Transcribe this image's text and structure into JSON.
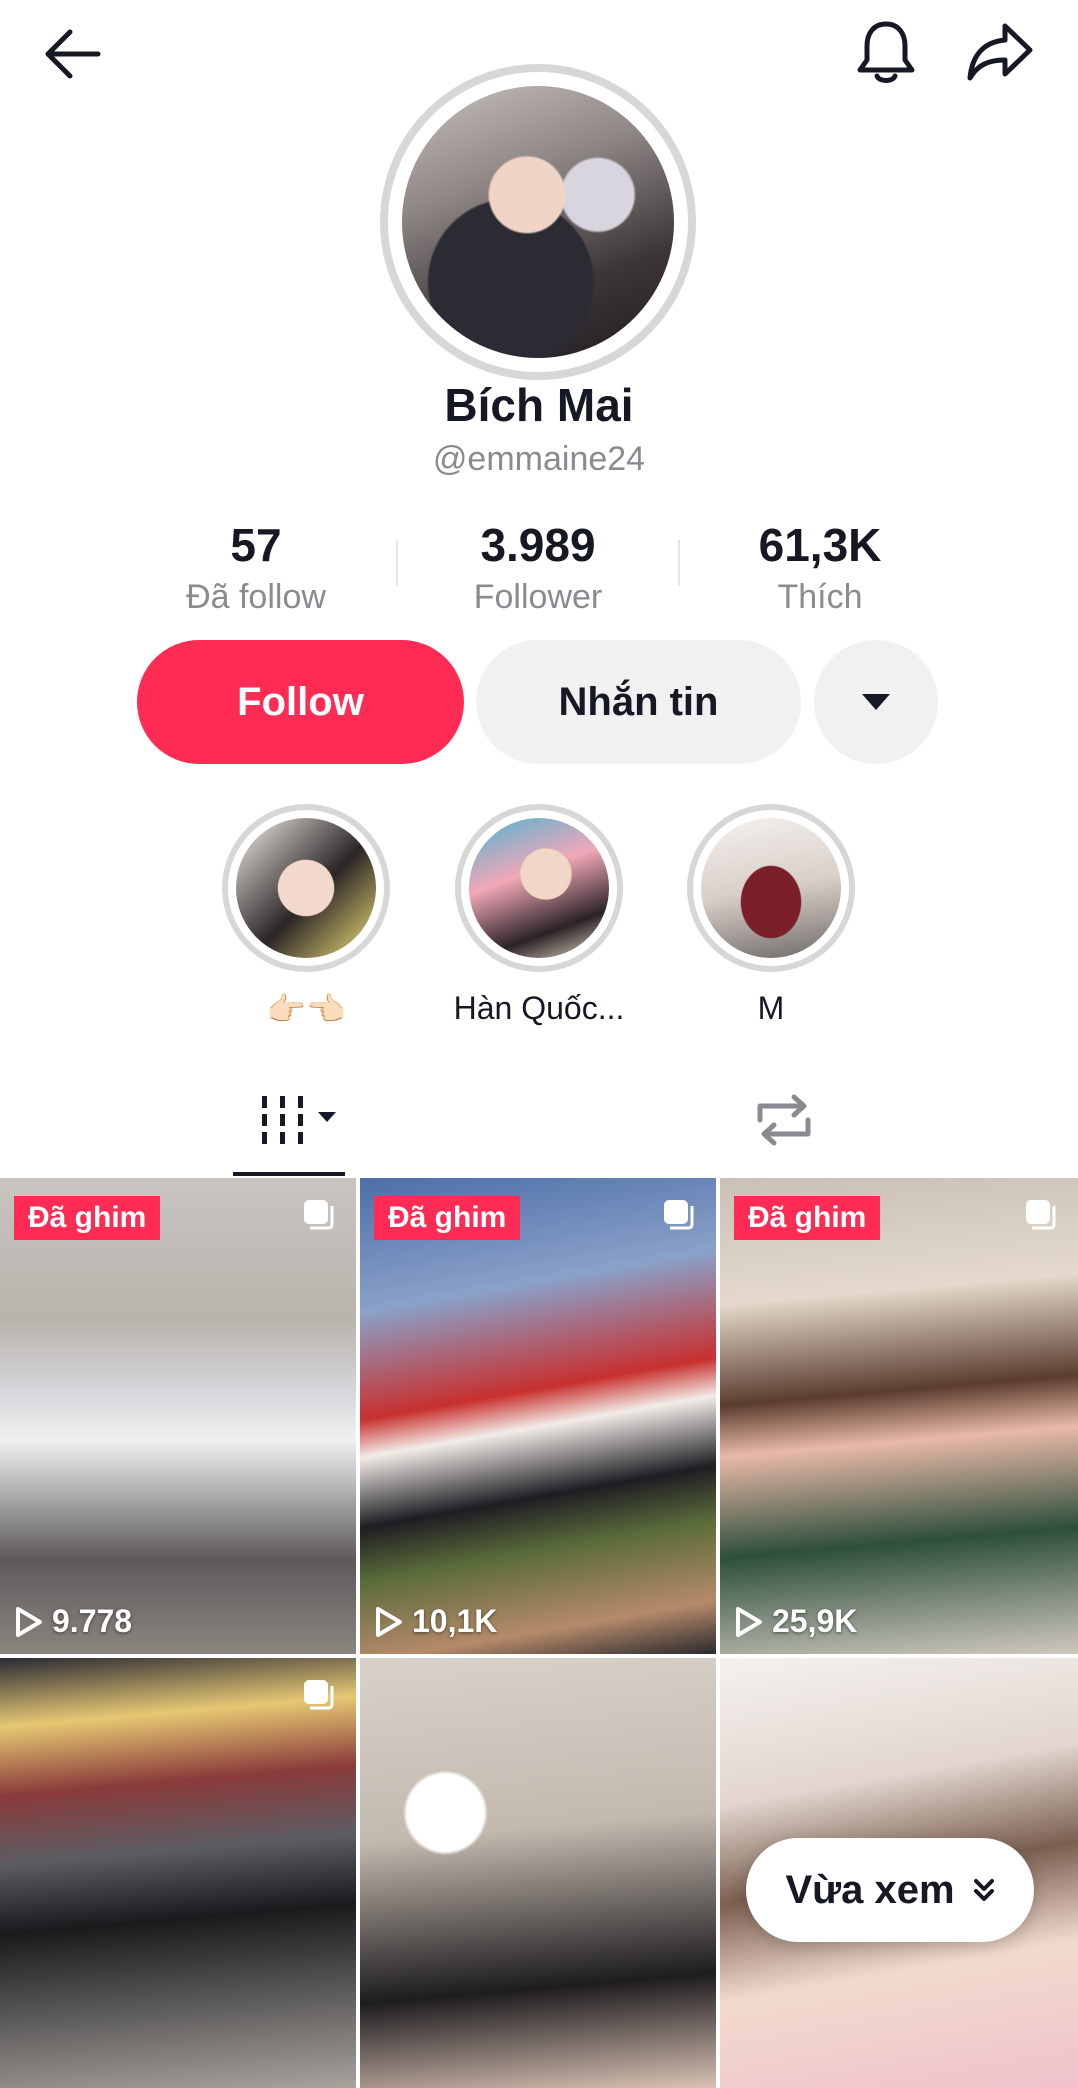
{
  "header": {
    "back_icon": "arrow-left-icon",
    "bell_icon": "bell-icon",
    "share_icon": "share-icon"
  },
  "profile": {
    "name": "Bích Mai",
    "handle": "@emmaine24"
  },
  "stats": [
    {
      "value": "57",
      "label": "Đã follow"
    },
    {
      "value": "3.989",
      "label": "Follower"
    },
    {
      "value": "61,3K",
      "label": "Thích"
    }
  ],
  "actions": {
    "follow_label": "Follow",
    "message_label": "Nhắn tin",
    "more_icon": "caret-down-icon"
  },
  "highlights": [
    {
      "label": "👉🏻👈🏻"
    },
    {
      "label": "Hàn Quốc..."
    },
    {
      "label": "M"
    }
  ],
  "tabs": {
    "videos_icon": "videos-grid-icon",
    "reposts_icon": "repost-icon"
  },
  "videos": [
    {
      "pinned_label": "Đã ghim",
      "views": "9.778"
    },
    {
      "pinned_label": "Đã ghim",
      "views": "10,1K"
    },
    {
      "pinned_label": "Đã ghim",
      "views": "25,9K"
    },
    {
      "pinned_label": "",
      "views": ""
    },
    {
      "pinned_label": "",
      "views": ""
    },
    {
      "pinned_label": "",
      "views": ""
    }
  ],
  "recently_viewed": {
    "label": "Vừa xem",
    "icon": "double-chevron-down-icon"
  }
}
